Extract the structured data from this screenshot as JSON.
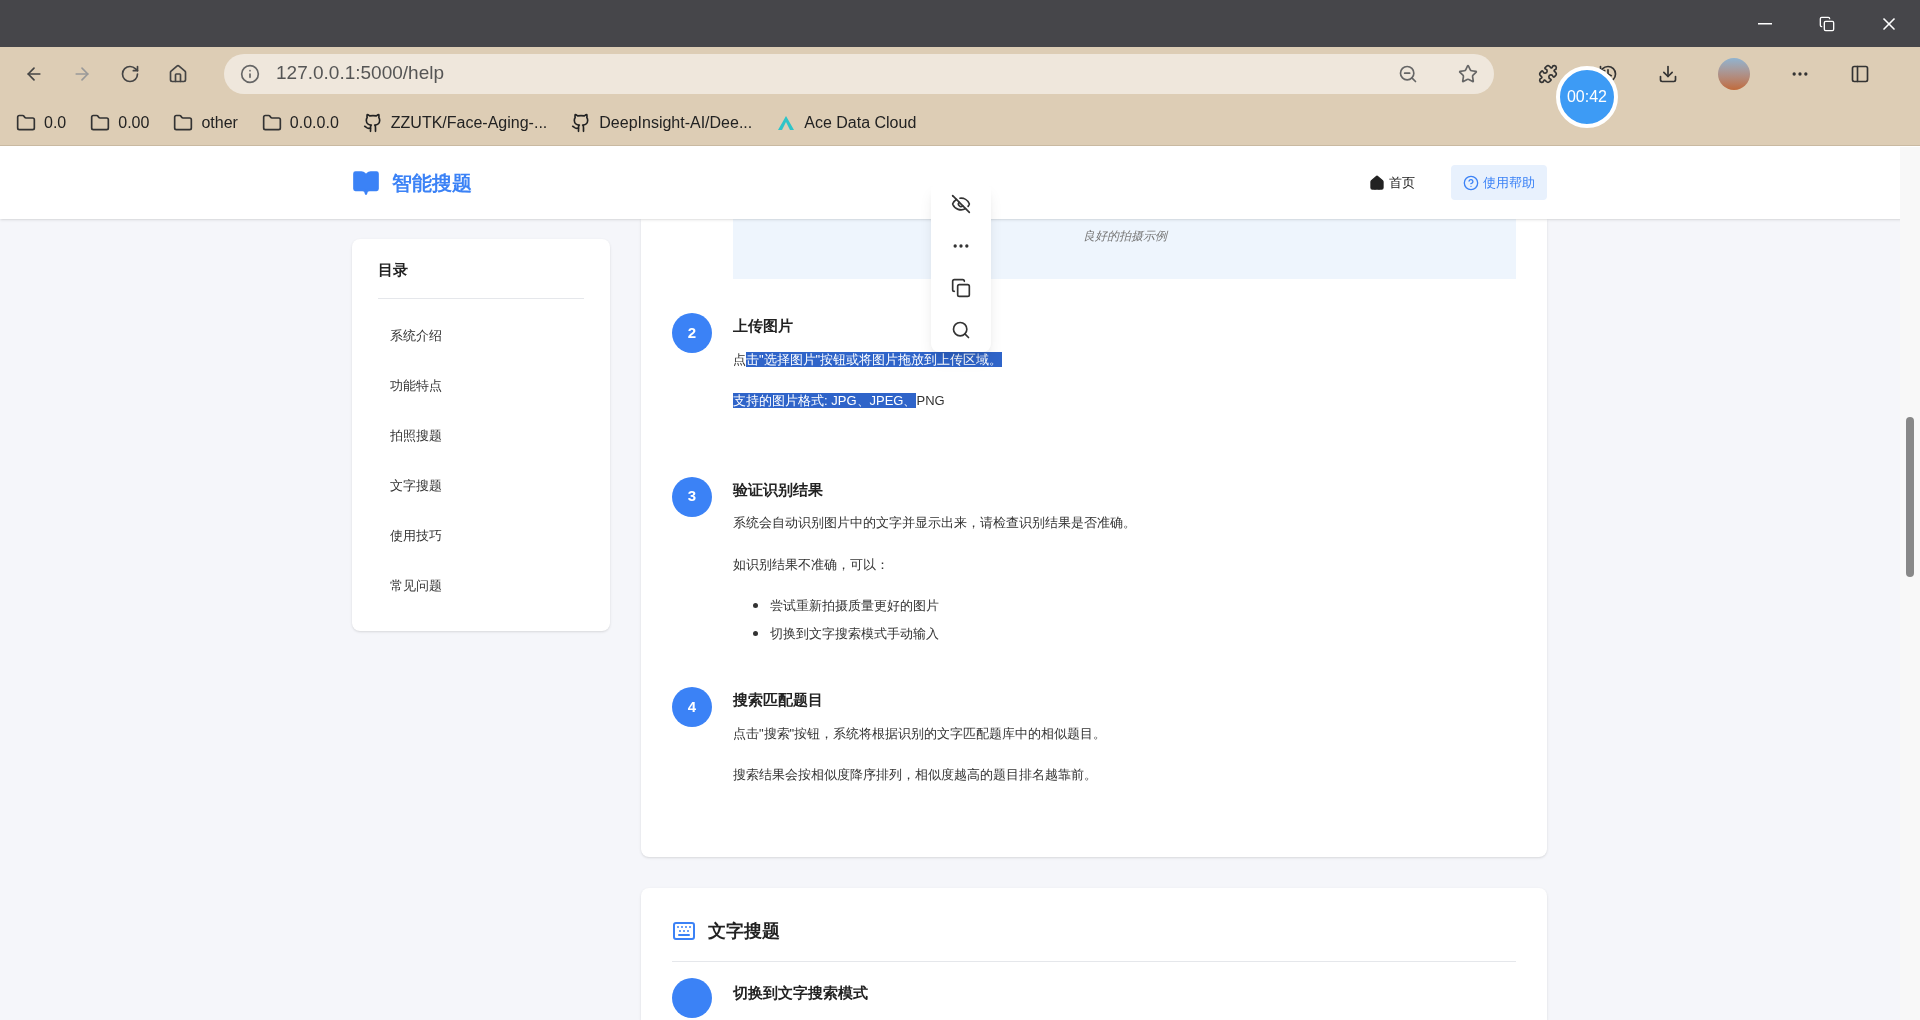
{
  "browser": {
    "url": "127.0.0.1:5000/help",
    "timer": "00:42",
    "bookmarks": [
      {
        "label": "0.0",
        "kind": "folder"
      },
      {
        "label": "0.00",
        "kind": "folder"
      },
      {
        "label": "other",
        "kind": "folder"
      },
      {
        "label": "0.0.0.0",
        "kind": "folder"
      },
      {
        "label": "ZZUTK/Face-Aging-...",
        "kind": "github"
      },
      {
        "label": "DeepInsight-AI/Dee...",
        "kind": "github"
      },
      {
        "label": "Ace Data Cloud",
        "kind": "ace"
      }
    ]
  },
  "header": {
    "logo": "智能搜题",
    "nav": [
      {
        "label": "首页",
        "selected": false
      },
      {
        "label": "使用帮助",
        "selected": true
      }
    ]
  },
  "toc": {
    "title": "目录",
    "items": [
      {
        "label": "系统介绍"
      },
      {
        "label": "功能特点"
      },
      {
        "label": "拍照搜题"
      },
      {
        "label": "文字搜题"
      },
      {
        "label": "使用技巧"
      },
      {
        "label": "常见问题"
      }
    ]
  },
  "photo_section": {
    "image_caption": "良好的拍摄示例",
    "steps": [
      {
        "number": "2",
        "title": "上传图片",
        "paragraphs": [
          [
            {
              "text": "点",
              "selected": false
            },
            {
              "text": "击\"选择图片\"按钮或将图片拖放到上传区域。",
              "selected": true
            }
          ],
          [
            {
              "text": "支持的图片格式: JPG、JPEG、",
              "selected": true
            },
            {
              "text": "PNG",
              "selected": false
            }
          ]
        ]
      },
      {
        "number": "3",
        "title": "验证识别结果",
        "paragraphs": [
          [
            {
              "text": "系统会自动识别图片中的文字并显示出来，请检查识别结果是否准确。",
              "selected": false
            }
          ],
          [
            {
              "text": "如识别结果不准确，可以：",
              "selected": false
            }
          ]
        ],
        "bullets": [
          "尝试重新拍摄质量更好的图片",
          "切换到文字搜索模式手动输入"
        ]
      },
      {
        "number": "4",
        "title": "搜索匹配题目",
        "paragraphs": [
          [
            {
              "text": "点击\"搜索\"按钮，系统将根据识别的文字匹配题库中的相似题目。",
              "selected": false
            }
          ],
          [
            {
              "text": "搜索结果会按相似度降序排列，相似度越高的题目排名越靠前。",
              "selected": false
            }
          ]
        ]
      }
    ]
  },
  "text_section": {
    "title": "文字搜题",
    "first_step_title": "切换到文字搜索模式"
  }
}
